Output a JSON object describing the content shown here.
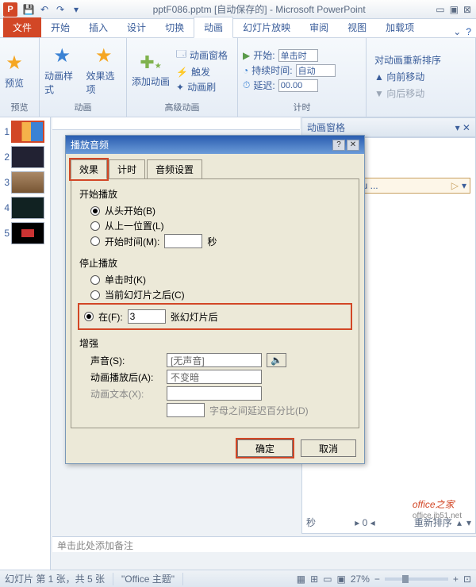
{
  "title": "pptF086.pptm [自动保存的] - Microsoft PowerPoint",
  "app_icon": "P",
  "tabs": {
    "file": "文件",
    "home": "开始",
    "insert": "插入",
    "design": "设计",
    "transitions": "切换",
    "animations": "动画",
    "slideshow": "幻灯片放映",
    "review": "审阅",
    "view": "视图",
    "addins": "加载项"
  },
  "ribbon": {
    "preview_btn": "预览",
    "preview_grp": "预览",
    "anim_styles": "动画样式",
    "effect_options": "效果选项",
    "anim_grp": "动画",
    "add_anim": "添加动画",
    "anim_pane": "动画窗格",
    "trigger": "触发",
    "anim_painter": "动画刷",
    "adv_grp": "高级动画",
    "start": "开始:",
    "start_val": "单击时",
    "duration": "持续时间:",
    "duration_val": "自动",
    "delay": "延迟:",
    "delay_val": "00.00",
    "timing_grp": "计时",
    "reorder_title": "对动画重新排序",
    "move_up": "向前移动",
    "move_down": "向后移动"
  },
  "slides": [
    "1",
    "2",
    "3",
    "4",
    "5"
  ],
  "pane": {
    "title": "动画窗格",
    "item": "ows In You ..."
  },
  "pane_footer": {
    "seconds_label": "秒",
    "time0": "0",
    "reorder_btn": "重新排序"
  },
  "dialog": {
    "title": "播放音频",
    "tabs": {
      "effect": "效果",
      "timing": "计时",
      "audio": "音频设置"
    },
    "start_section": "开始播放",
    "from_begin": "从头开始(B)",
    "from_last": "从上一位置(L)",
    "start_time": "开始时间(M):",
    "start_time_val": "",
    "sec": "秒",
    "stop_section": "停止播放",
    "on_click": "单击时(K)",
    "after_current": "当前幻灯片之后(C)",
    "after_n_prefix": "在(F):",
    "after_n_val": "3",
    "after_n_suffix": "张幻灯片后",
    "enhance_section": "增强",
    "sound": "声音(S):",
    "sound_val": "[无声音]",
    "after_play": "动画播放后(A):",
    "after_play_val": "不变暗",
    "anim_text": "动画文本(X):",
    "anim_text_val": "",
    "letter_delay": "字母之间延迟百分比(D)",
    "ok": "确定",
    "cancel": "取消"
  },
  "notes": "单击此处添加备注",
  "status": {
    "slide": "幻灯片 第 1 张，共 5 张",
    "theme": "\"Office 主题\"",
    "lang": "",
    "zoom": "27%"
  },
  "watermark": {
    "main": "office之家",
    "sub": "office.jb51.net"
  }
}
